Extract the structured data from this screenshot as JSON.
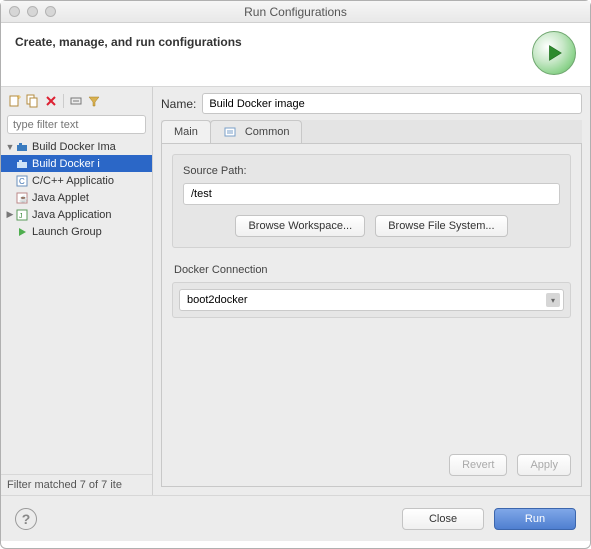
{
  "window": {
    "title": "Run Configurations"
  },
  "header": {
    "title": "Create, manage, and run configurations"
  },
  "sidebar": {
    "filter_placeholder": "type filter text",
    "items": [
      {
        "label": "Build Docker Ima",
        "expanded": true,
        "icon": "docker",
        "children": [
          {
            "label": "Build Docker i",
            "selected": true,
            "icon": "docker"
          }
        ]
      },
      {
        "label": "C/C++ Applicatio",
        "icon": "c"
      },
      {
        "label": "Java Applet",
        "icon": "java"
      },
      {
        "label": "Java Application",
        "icon": "java",
        "expandable": true
      },
      {
        "label": "Launch Group",
        "icon": "launch"
      }
    ],
    "status": "Filter matched 7 of 7 ite"
  },
  "form": {
    "name_label": "Name:",
    "name_value": "Build Docker image",
    "tabs": [
      {
        "label": "Main",
        "active": true
      },
      {
        "label": "Common",
        "active": false
      }
    ],
    "main": {
      "source_label": "Source Path:",
      "source_value": "/test",
      "browse_ws": "Browse Workspace...",
      "browse_fs": "Browse File System...",
      "conn_label": "Docker Connection",
      "conn_value": "boot2docker"
    },
    "revert": "Revert",
    "apply": "Apply"
  },
  "footer": {
    "close": "Close",
    "run": "Run"
  }
}
